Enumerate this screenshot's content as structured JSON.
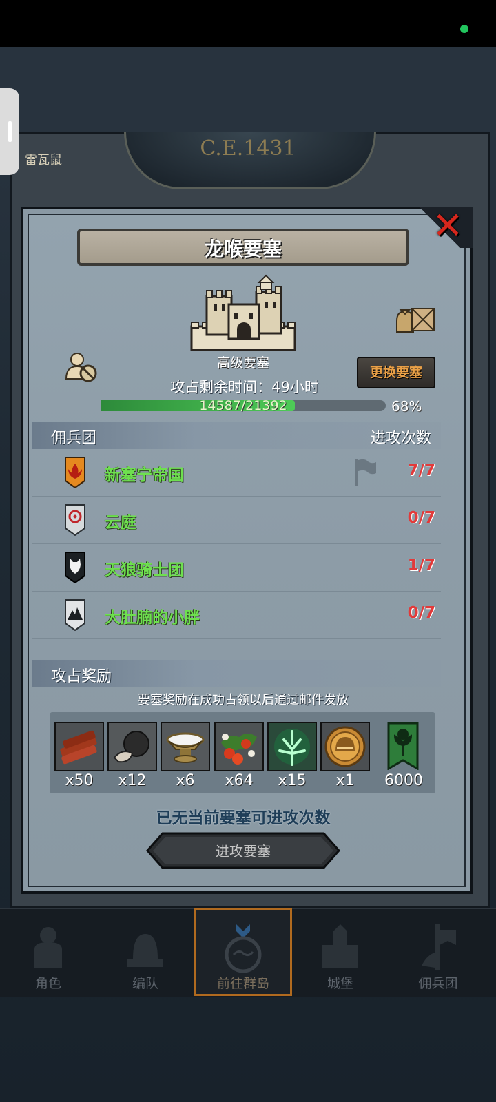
{
  "game": {
    "era": "C.E.1431",
    "left_label": "雷瓦鼠"
  },
  "dialog": {
    "title": "龙喉要塞",
    "fortress_type": "高级要塞",
    "time_label": "攻占剩余时间：",
    "time_value": "49",
    "time_unit": "小时",
    "change_button": "更换要塞",
    "progress_text": "14587/21392",
    "progress_fraction": 0.68,
    "progress_pct": "68%",
    "section_mercenary": "佣兵团",
    "section_attacks": "进攻次数",
    "guilds": [
      {
        "name": "新塞宁帝国",
        "count": "7/7",
        "icon": "orange-flame-shield-icon"
      },
      {
        "name": "云庭",
        "count": "0/7",
        "icon": "red-ring-shield-icon"
      },
      {
        "name": "天狼骑士团",
        "count": "1/7",
        "icon": "wolf-shield-icon"
      },
      {
        "name": "大肚腩的小胖",
        "count": "0/7",
        "icon": "mountain-shield-icon"
      }
    ],
    "section_rewards": "攻占奖励",
    "reward_note": "要塞奖励在成功占领以后通过邮件发放",
    "rewards": [
      {
        "icon": "wood-logs-icon",
        "qty": "x50"
      },
      {
        "icon": "truffle-icon",
        "qty": "x12"
      },
      {
        "icon": "salt-bowl-icon",
        "qty": "x6"
      },
      {
        "icon": "berries-icon",
        "qty": "x64"
      },
      {
        "icon": "green-spirit-tree-icon",
        "qty": "x15"
      },
      {
        "icon": "golden-helmet-coin-icon",
        "qty": "x1"
      },
      {
        "icon": "tree-banner-icon",
        "qty": "6000"
      }
    ],
    "no_attack_text": "已无当前要塞可进攻次数",
    "attack_button": "进攻要塞"
  },
  "nav": [
    {
      "label": "角色",
      "icon": "knight-armor-icon"
    },
    {
      "label": "编队",
      "icon": "knight-helmet-icon"
    },
    {
      "label": "前往群岛",
      "icon": "compass-map-icon"
    },
    {
      "label": "城堡",
      "icon": "castle-icon"
    },
    {
      "label": "佣兵团",
      "icon": "mercenary-banner-icon"
    }
  ],
  "colors": {
    "accent_orange": "#e9a047",
    "guild_green": "#6ee04f",
    "count_red": "#e23a3a",
    "close_red": "#d7271d"
  }
}
